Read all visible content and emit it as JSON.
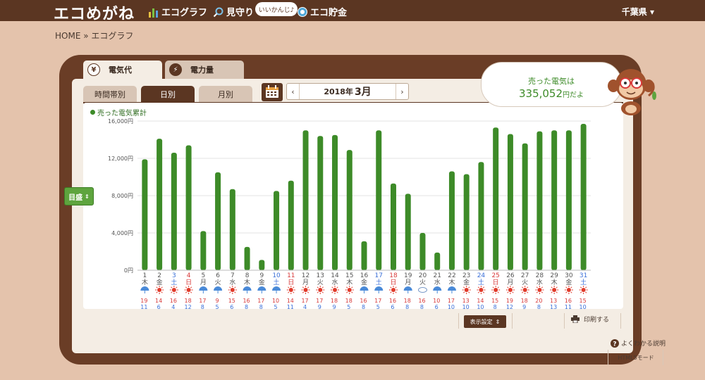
{
  "header": {
    "logo": "エコめがね",
    "nav": [
      {
        "label": "エコグラフ",
        "icon": "bar-chart-icon"
      },
      {
        "label": "見守り",
        "icon": "magnifier-icon"
      },
      {
        "label": "エコ貯金",
        "icon": "coin-icon"
      }
    ],
    "bubble": "いいかんじ♪",
    "region": "千葉県 ▾"
  },
  "breadcrumb": "HOME » エコグラフ",
  "main_tabs": [
    {
      "label": "電気代",
      "icon": "yen-icon",
      "icon_text": "¥"
    },
    {
      "label": "電力量",
      "icon": "lightning-icon",
      "icon_text": "⚡"
    }
  ],
  "sub_tabs": [
    "時間帯別",
    "日別",
    "月別"
  ],
  "active_sub_tab": "日別",
  "date": {
    "year": "2018年",
    "month": "3月",
    "prev": "‹",
    "next": "›"
  },
  "speech": {
    "line1": "売った電気は",
    "amount": "335,052",
    "suffix": "円だよ"
  },
  "legend": "売った電気累計",
  "goal_button": "目盛",
  "display_button": "表示設定",
  "print_button": "印刷する",
  "help_link": "よくわかる説明",
  "html5_button": "HTML5モード",
  "colors": {
    "bar": "#3d8b28",
    "saturday": "#3a6fd8",
    "sunday": "#d83a3a",
    "weekday": "#555555"
  },
  "chart_data": {
    "type": "bar",
    "title": "",
    "legend": [
      "売った電気累計"
    ],
    "ylim": [
      0,
      16000
    ],
    "yticks": [
      "0円",
      "4,000円",
      "8,000円",
      "12,000円",
      "16,000円"
    ],
    "categories": [
      "1",
      "2",
      "3",
      "4",
      "5",
      "6",
      "7",
      "8",
      "9",
      "10",
      "11",
      "12",
      "13",
      "14",
      "15",
      "16",
      "17",
      "18",
      "19",
      "20",
      "21",
      "22",
      "23",
      "24",
      "25",
      "26",
      "27",
      "28",
      "29",
      "30",
      "31"
    ],
    "weekdays": [
      "木",
      "金",
      "土",
      "日",
      "月",
      "火",
      "水",
      "木",
      "金",
      "土",
      "日",
      "月",
      "火",
      "水",
      "木",
      "金",
      "土",
      "日",
      "月",
      "火",
      "水",
      "木",
      "金",
      "土",
      "日",
      "月",
      "火",
      "水",
      "木",
      "金",
      "土"
    ],
    "values": [
      11900,
      14100,
      12600,
      13400,
      4200,
      10500,
      8700,
      2500,
      1100,
      8500,
      9600,
      15000,
      14400,
      14500,
      12900,
      3100,
      15000,
      9300,
      8200,
      4000,
      1900,
      10600,
      10300,
      11600,
      15300,
      14600,
      13600,
      14900,
      15000,
      15000,
      15700
    ],
    "weather": [
      "rain",
      "sun",
      "sun",
      "sun",
      "rain",
      "rain",
      "sun",
      "rain",
      "rain",
      "rain",
      "sun",
      "sun",
      "sun",
      "sun",
      "sun",
      "rain",
      "rain",
      "sun",
      "rain",
      "cloud",
      "rain",
      "rain",
      "sun",
      "sun",
      "sun",
      "sun",
      "sun",
      "sun",
      "sun",
      "sun",
      "sun"
    ],
    "temp_high": [
      "19",
      "14",
      "16",
      "18",
      "17",
      "9",
      "15",
      "16",
      "17",
      "10",
      "14",
      "17",
      "17",
      "18",
      "18",
      "16",
      "17",
      "16",
      "18",
      "16",
      "10",
      "17",
      "13",
      "14",
      "15",
      "19",
      "18",
      "20",
      "13",
      "16",
      "15"
    ],
    "temp_low": [
      "11",
      "6",
      "4",
      "12",
      "8",
      "5",
      "6",
      "8",
      "8",
      "5",
      "11",
      "4",
      "9",
      "9",
      "5",
      "8",
      "5",
      "6",
      "8",
      "8",
      "6",
      "10",
      "10",
      "10",
      "8",
      "12",
      "9",
      "8",
      "13",
      "11",
      "10"
    ]
  }
}
